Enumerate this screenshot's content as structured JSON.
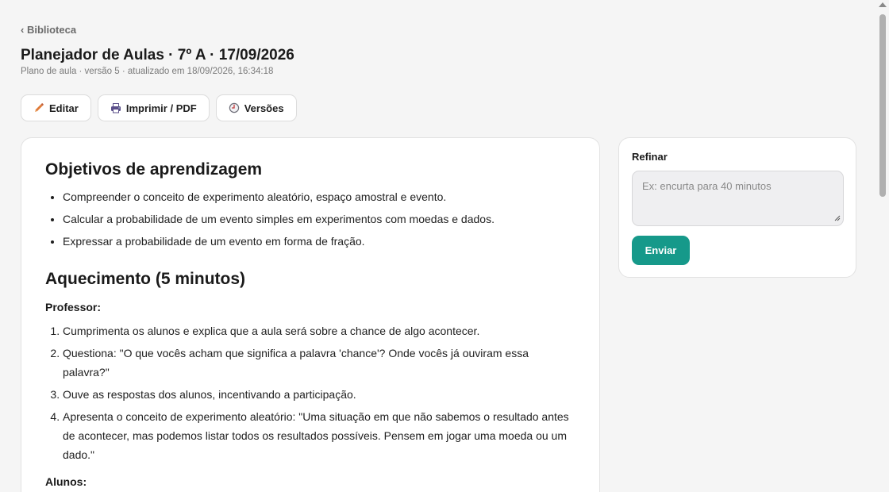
{
  "nav": {
    "back_label": "‹ Biblioteca"
  },
  "header": {
    "title": "Planejador de Aulas · 7º A · 17/09/2026",
    "subtitle": "Plano de aula · versão 5 · atualizado em 18/09/2026, 16:34:18"
  },
  "toolbar": {
    "edit_label": "Editar",
    "print_label": "Imprimir / PDF",
    "versions_label": "Versões",
    "edit_icon": "pencil-icon",
    "print_icon": "printer-icon",
    "versions_icon": "clock-icon"
  },
  "plan": {
    "objectives_title": "Objetivos de aprendizagem",
    "objectives": [
      "Compreender o conceito de experimento aleatório, espaço amostral e evento.",
      "Calcular a probabilidade de um evento simples em experimentos com moedas e dados.",
      "Expressar a probabilidade de um evento em forma de fração."
    ],
    "warmup_title": "Aquecimento (5 minutos)",
    "teacher_label": "Professor:",
    "teacher_steps": [
      "Cumprimenta os alunos e explica que a aula será sobre a chance de algo acontecer.",
      "Questiona: \"O que vocês acham que significa a palavra 'chance'? Onde vocês já ouviram essa palavra?\"",
      "Ouve as respostas dos alunos, incentivando a participação.",
      "Apresenta o conceito de experimento aleatório: \"Uma situação em que não sabemos o resultado antes de acontecer, mas podemos listar todos os resultados possíveis. Pensem em jogar uma moeda ou um dado.\""
    ],
    "students_label": "Alunos:"
  },
  "refine": {
    "title": "Refinar",
    "placeholder": "Ex: encurta para 40 minutos",
    "value": "",
    "submit_label": "Enviar"
  },
  "colors": {
    "accent": "#16998a",
    "background": "#f5f5f5",
    "card": "#ffffff",
    "pencil": "#e07b39",
    "printer": "#5b4f8a"
  }
}
